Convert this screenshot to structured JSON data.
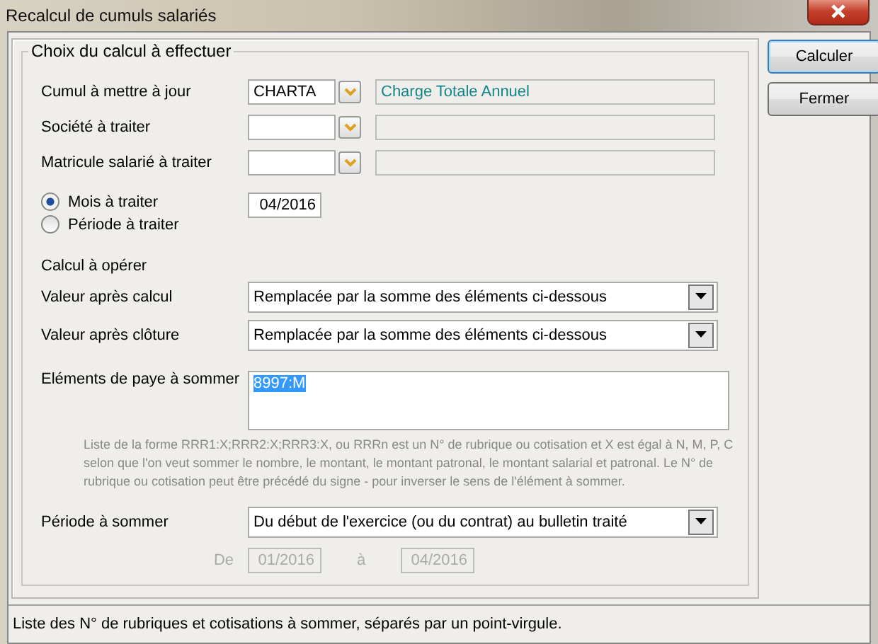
{
  "window": {
    "title": "Recalcul de cumuls salariés"
  },
  "group": {
    "title": "Choix du calcul à effectuer"
  },
  "lookups": [
    {
      "label": "Cumul à mettre à jour",
      "value": "CHARTA",
      "description": "Charge Totale Annuel"
    },
    {
      "label": "Société à traiter"
    },
    {
      "label": "Matricule salarié à traiter"
    }
  ],
  "modes": [
    {
      "label": "Mois à traiter",
      "selected": true
    },
    {
      "label": "Période à traiter",
      "selected": false
    }
  ],
  "month": {
    "value": "04/2016"
  },
  "calc": {
    "title": "Calcul à opérer",
    "rows": [
      {
        "label": "Valeur après calcul",
        "value": "Remplacée par la somme des éléments ci-dessous"
      },
      {
        "label": "Valeur après clôture",
        "value": "Remplacée par la somme des éléments ci-dessous"
      }
    ]
  },
  "elements": {
    "label": "Eléments de paye à sommer",
    "value": "8997:M",
    "selected": true
  },
  "help": "Liste de la forme RRR1:X;RRR2:X;RRR3:X, ou RRRn est un N° de rubrique ou cotisation et X est égal à  N, M, P, C selon que l'on veut sommer le nombre, le montant, le montant patronal, le montant salarial et patronal. Le N° de rubrique ou cotisation peut être précédé du signe - pour inverser le sens de l'élément à sommer.",
  "period": {
    "label": "Période à sommer",
    "value": "Du début de l'exercice (ou du contrat) au bulletin traité"
  },
  "range": {
    "from_label": "De",
    "from": "01/2016",
    "to_label": "à",
    "to": "04/2016",
    "disabled": true
  },
  "buttons": [
    {
      "label": "Calculer",
      "default": true
    },
    {
      "label": "Fermer",
      "default": false
    }
  ],
  "status_bar": "Liste des N° de rubriques et cotisations à sommer, séparés par un point-virgule."
}
